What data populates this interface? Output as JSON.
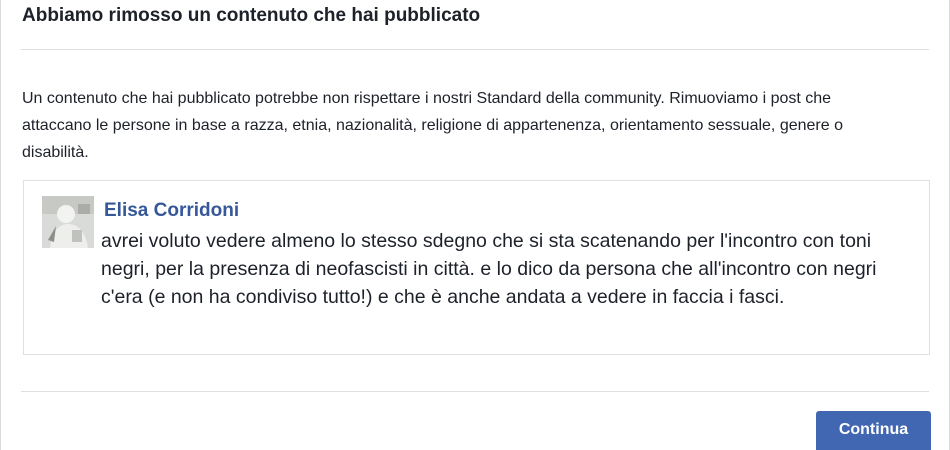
{
  "dialog": {
    "title": "Abbiamo rimosso un contenuto che hai pubblicato",
    "message": "Un contenuto che hai pubblicato potrebbe non rispettare i nostri Standard della community. Rimuoviamo i post che attaccano le persone in base a razza, etnia, nazionalità, religione di appartenenza, orientamento sessuale, genere o disabilità."
  },
  "post": {
    "author": "Elisa Corridoni",
    "text": "avrei voluto vedere almeno lo stesso sdegno che si sta scatenando per l'incontro con toni negri, per la presenza di neofascisti in città. e lo dico da persona che all'incontro con negri c'era (e non ha condiviso tutto!) e che è anche andata a vedere in faccia i fasci.",
    "avatar_icon": "user-avatar-photo"
  },
  "footer": {
    "continue_label": "Continua"
  },
  "colors": {
    "primary_button": "#4267b2",
    "author_link": "#365899",
    "text": "#1d2129",
    "divider": "#dddfe2"
  }
}
